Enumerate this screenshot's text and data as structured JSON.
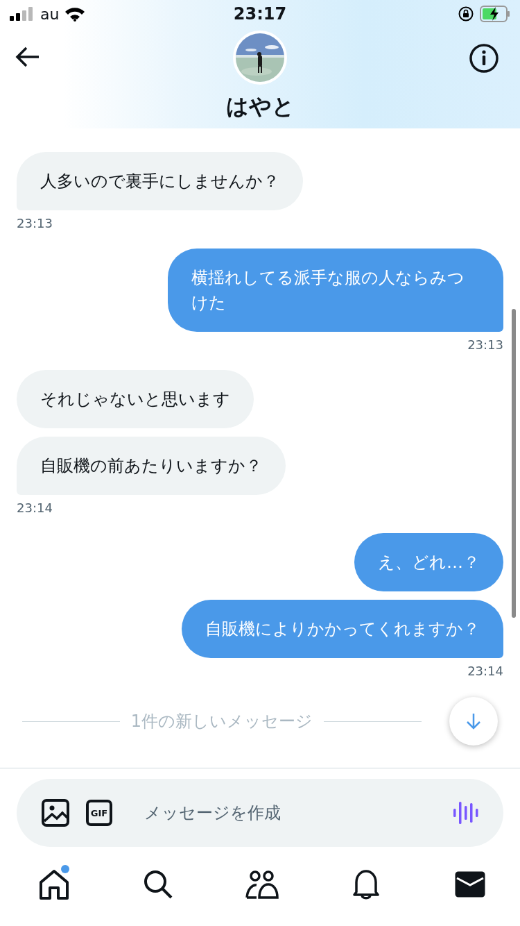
{
  "status_bar": {
    "carrier": "au",
    "time": "23:17"
  },
  "header": {
    "name": "はやと"
  },
  "messages": [
    {
      "kind": "message",
      "sent": false,
      "text": "人多いので裏手にしませんか？",
      "tail": true
    },
    {
      "kind": "time",
      "sent": false,
      "text": "23:13"
    },
    {
      "kind": "message",
      "sent": true,
      "text": "横揺れしてる派手な服の人ならみつけた",
      "tail": true
    },
    {
      "kind": "time",
      "sent": true,
      "text": "23:13"
    },
    {
      "kind": "message",
      "sent": false,
      "text": "それじゃないと思います",
      "tail": false
    },
    {
      "kind": "message",
      "sent": false,
      "text": "自販機の前あたりいますか？",
      "tail": true
    },
    {
      "kind": "time",
      "sent": false,
      "text": "23:14"
    },
    {
      "kind": "message",
      "sent": true,
      "text": "え、どれ…？",
      "tail": false
    },
    {
      "kind": "message",
      "sent": true,
      "text": "自販機によりかかってくれますか？",
      "tail": true
    },
    {
      "kind": "time",
      "sent": true,
      "text": "23:14"
    }
  ],
  "new_messages": {
    "label": "1件の新しいメッセージ"
  },
  "composer": {
    "placeholder": "メッセージを作成",
    "gif_label": "GIF"
  },
  "nav": [
    {
      "kind": "home",
      "selected": false,
      "badge": true
    },
    {
      "kind": "search",
      "selected": false,
      "badge": false
    },
    {
      "kind": "people",
      "selected": false,
      "badge": false
    },
    {
      "kind": "bell",
      "selected": false,
      "badge": false
    },
    {
      "kind": "mail",
      "selected": true,
      "badge": false
    }
  ]
}
